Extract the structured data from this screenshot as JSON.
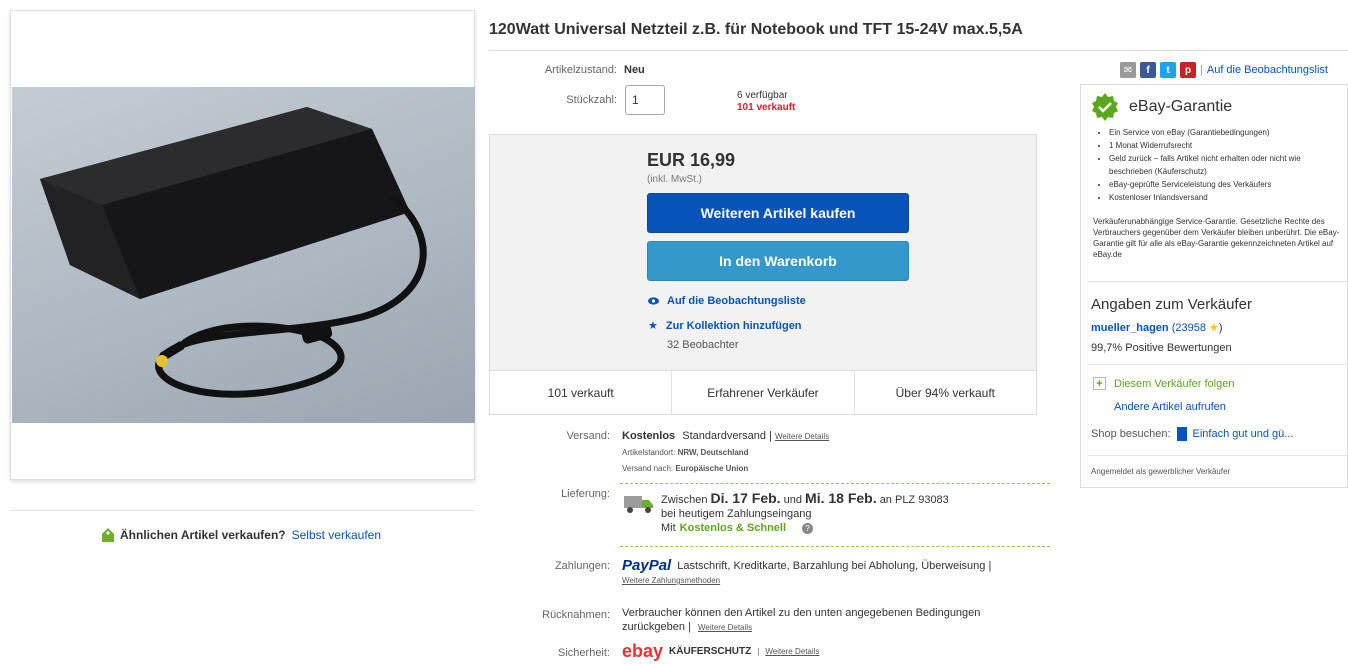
{
  "title": "120Watt Universal Netzteil z.B. für Notebook und TFT 15-24V max.5,5A",
  "condition": {
    "label": "Artikelzustand:",
    "value": "Neu"
  },
  "quantity": {
    "label": "Stückzahl:",
    "value": "1",
    "available": "6 verfügbar",
    "sold": "101 verkauft"
  },
  "price": {
    "value": "EUR 16,99",
    "tax_note": "(inkl. MwSt.)"
  },
  "buttons": {
    "buy": "Weiteren Artikel kaufen",
    "cart": "In den Warenkorb"
  },
  "links": {
    "watch": "Auf die Beobachtungsliste",
    "collection": "Zur Kollektion hinzufügen",
    "watchers": "32 Beobachter"
  },
  "stats": [
    "101 verkauft",
    "Erfahrener Verkäufer",
    "Über 94% verkauft"
  ],
  "shipping": {
    "label": "Versand:",
    "cost": "Kostenlos",
    "method": "Standardversand |",
    "details": "Weitere Details",
    "location_label": "Artikelstandort:",
    "location": "NRW, Deutschland",
    "to_label": "Versand nach:",
    "to": "Europäische Union"
  },
  "delivery": {
    "label": "Lieferung:",
    "prefix": "Zwischen",
    "from": "Di. 17 Feb.",
    "and": "und",
    "to": "Mi. 18 Feb.",
    "plz": "an PLZ 93083",
    "line2": "bei heutigem Zahlungseingang",
    "with": "Mit",
    "badge": "Kostenlos & Schnell"
  },
  "payment": {
    "label": "Zahlungen:",
    "paypal": "PayPal",
    "methods": "Lastschrift, Kreditkarte, Barzahlung bei Abholung, Überweisung |",
    "more": "Weitere Zahlungsmethoden"
  },
  "returns": {
    "label": "Rücknahmen:",
    "text": "Verbraucher können den Artikel zu den unten angegebenen Bedingungen",
    "text2": "zurückgeben |",
    "details": "Weitere Details"
  },
  "security": {
    "label": "Sicherheit:",
    "ebay": "ebay",
    "text": "KÄUFERSCHUTZ",
    "details": "Weitere Details"
  },
  "similar": {
    "text": "Ähnlichen Artikel verkaufen?",
    "link": "Selbst verkaufen"
  },
  "share": {
    "watch_link": "Auf die Beobachtungslist"
  },
  "guarantee": {
    "title": "eBay-Garantie",
    "items": [
      "Ein Service von eBay (Garantiebedingungen)",
      "1 Monat Widerrufsrecht",
      "Geld zurück – falls Artikel nicht erhalten oder nicht wie beschrieben (Käuferschutz)",
      "eBay-geprüfte Serviceleistung des Verkäufers",
      "Kostenloser Inlandsversand"
    ],
    "note": "Verkäuferunabhängige Service-Garantie. Gesetzliche Rechte des Verbrauchers gegenüber dem Verkäufer bleiben unberührt. Die eBay-Garantie gilt für alle als eBay-Garantie gekennzeichneten Artikel auf eBay.de"
  },
  "seller": {
    "heading": "Angaben zum Verkäufer",
    "name": "mueller_hagen",
    "score": "(23958",
    "score_end": ")",
    "positive": "99,7% Positive Bewertungen",
    "follow": "Diesem Verkäufer folgen",
    "more": "Andere Artikel aufrufen",
    "shop_label": "Shop besuchen:",
    "shop": "Einfach gut und gü...",
    "type": "Angemeldet als gewerblicher Verkäufer"
  },
  "colors": {
    "link": "#0654ba",
    "buy": "#0654ba",
    "cart": "#3498ca",
    "sold": "#dd1e31",
    "green": "#5ba71b"
  }
}
